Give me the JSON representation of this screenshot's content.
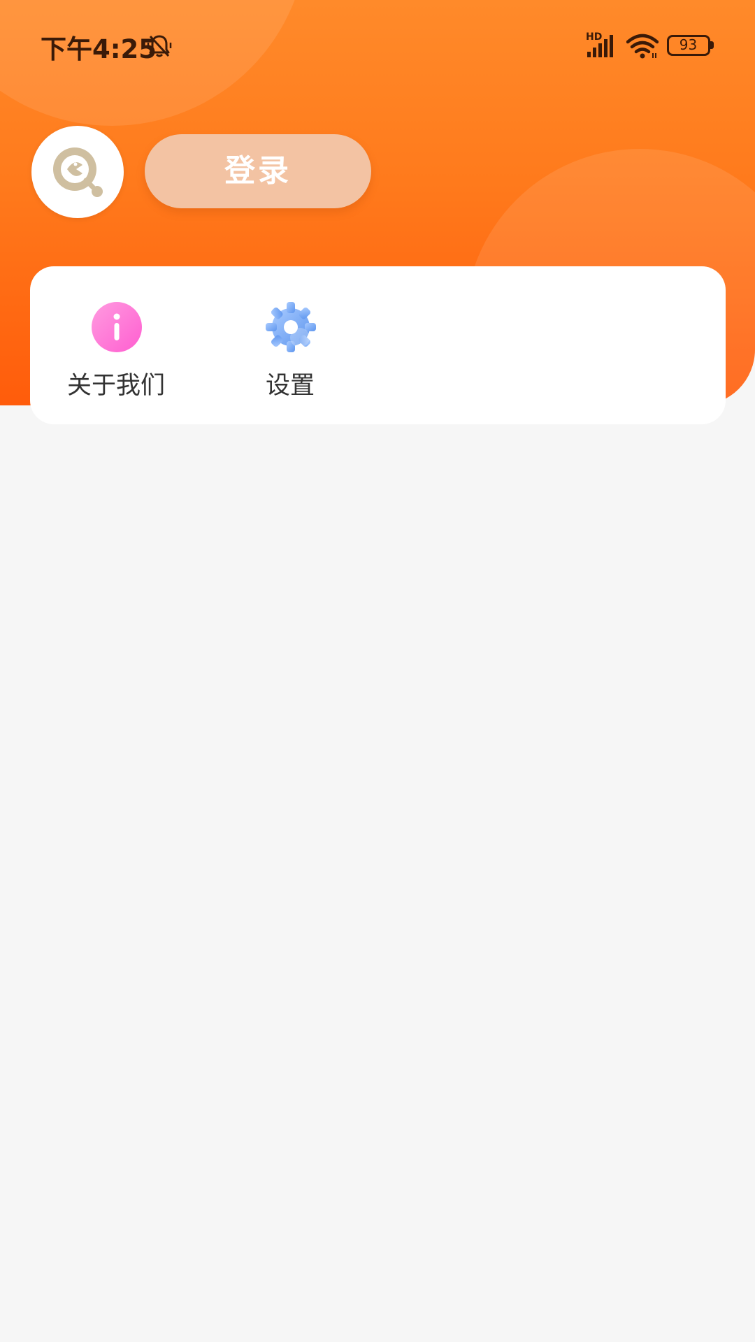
{
  "status_bar": {
    "time": "下午4:25",
    "network_badge": "HD",
    "battery_level": "93",
    "icons": [
      "silent-bell-icon",
      "signal-icon",
      "wifi-icon",
      "battery-icon"
    ]
  },
  "profile": {
    "avatar_icon": "app-logo-icon",
    "login_label": "登录"
  },
  "menu": {
    "items": [
      {
        "label": "关于我们",
        "icon": "info-icon"
      },
      {
        "label": "设置",
        "icon": "gear-icon"
      }
    ]
  },
  "colors": {
    "header_top": "#ff8a2a",
    "header_bottom": "#ff5c0b",
    "login_button": "#f3c3a3",
    "background": "#f6f6f6",
    "info_icon": "#ff6ecf",
    "gear_icon": "#6aa2f2",
    "avatar_logo": "#cfbfa0"
  }
}
